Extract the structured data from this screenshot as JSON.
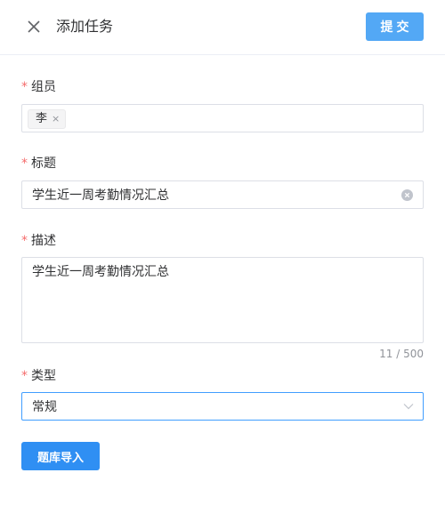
{
  "header": {
    "title": "添加任务",
    "submit_label": "提交",
    "close_icon": "close-icon"
  },
  "form": {
    "members": {
      "label": "组员",
      "required_mark": "*",
      "tags": [
        "李"
      ],
      "tag_remove_glyph": "×"
    },
    "title_field": {
      "label": "标题",
      "required_mark": "*",
      "value": "学生近一周考勤情况汇总",
      "clear_icon": "clear-circle-icon"
    },
    "description": {
      "label": "描述",
      "required_mark": "*",
      "value": "学生近一周考勤情况汇总",
      "counter": "11 / 500"
    },
    "type": {
      "label": "类型",
      "required_mark": "*",
      "selected": "常规",
      "chevron_icon": "chevron-down-icon"
    }
  },
  "import_label": "题库导入",
  "colors": {
    "primary": "#2f8ff3",
    "submit": "#53a8f5",
    "required": "#f56c6c",
    "focus_border": "#409eff"
  }
}
